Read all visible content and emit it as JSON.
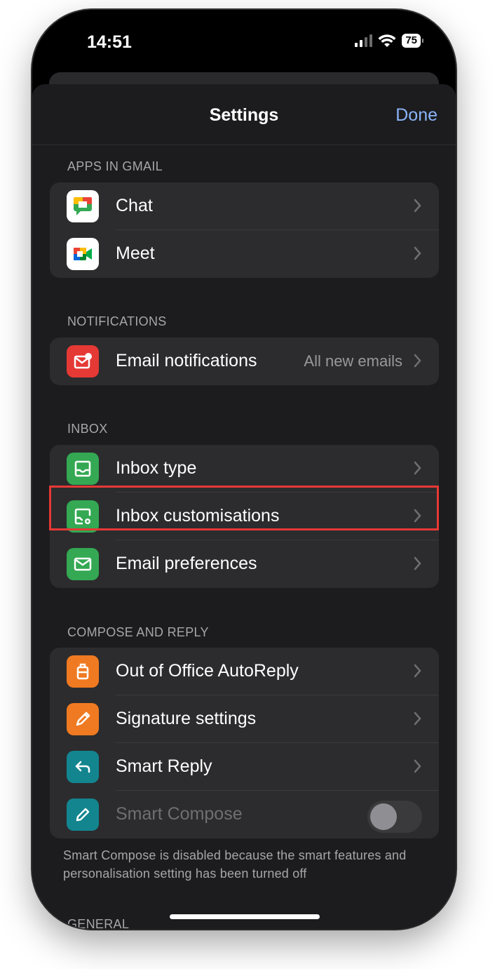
{
  "status_bar": {
    "time": "14:51",
    "battery": "75"
  },
  "nav": {
    "title": "Settings",
    "done_label": "Done"
  },
  "sections": {
    "apps": {
      "header": "APPS IN GMAIL",
      "items": [
        {
          "label": "Chat",
          "icon": "google-chat-icon"
        },
        {
          "label": "Meet",
          "icon": "google-meet-icon"
        }
      ]
    },
    "notifications": {
      "header": "NOTIFICATIONS",
      "items": [
        {
          "label": "Email notifications",
          "value": "All new emails",
          "icon": "mail-notification-icon",
          "color": "#e53935"
        }
      ]
    },
    "inbox": {
      "header": "INBOX",
      "items": [
        {
          "label": "Inbox type",
          "icon": "inbox-tray-icon",
          "color": "#34a853"
        },
        {
          "label": "Inbox customisations",
          "icon": "inbox-settings-icon",
          "color": "#34a853",
          "highlighted": true
        },
        {
          "label": "Email preferences",
          "icon": "envelope-icon",
          "color": "#34a853"
        }
      ]
    },
    "compose": {
      "header": "COMPOSE AND REPLY",
      "items": [
        {
          "label": "Out of Office AutoReply",
          "icon": "suitcase-icon",
          "color": "#f07a21"
        },
        {
          "label": "Signature settings",
          "icon": "pen-icon",
          "color": "#f07a21"
        },
        {
          "label": "Smart Reply",
          "icon": "reply-arrow-icon",
          "color": "#13858f"
        },
        {
          "label": "Smart Compose",
          "icon": "pencil-icon",
          "color": "#13858f",
          "toggle": false,
          "disabled": true
        }
      ],
      "footnote": "Smart Compose is disabled because the smart features and personalisation setting has been turned off"
    },
    "general": {
      "header": "GENERAL"
    }
  }
}
